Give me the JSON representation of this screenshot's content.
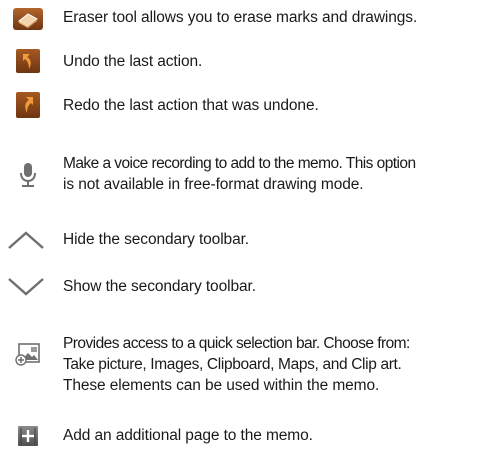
{
  "entries": [
    {
      "icon": "eraser-icon",
      "lines": [
        "Eraser tool allows you to erase marks and drawings."
      ]
    },
    {
      "icon": "undo-icon",
      "lines": [
        "Undo the last action."
      ]
    },
    {
      "icon": "redo-icon",
      "lines": [
        "Redo the last action that was undone."
      ]
    },
    {
      "icon": "microphone-icon",
      "lines": [
        "Make a voice recording to add to the memo. This option",
        "is not available in free-format drawing mode."
      ]
    },
    {
      "icon": "chevron-up-icon",
      "lines": [
        "Hide the secondary toolbar."
      ]
    },
    {
      "icon": "chevron-down-icon",
      "lines": [
        "Show the secondary toolbar."
      ]
    },
    {
      "icon": "insert-media-icon",
      "lines": [
        "Provides access to a quick selection bar. Choose from:",
        "Take picture, Images, Clipboard, Maps, and Clip art.",
        "These elements can be used within the memo."
      ]
    },
    {
      "icon": "add-page-icon",
      "lines": [
        "Add an additional page to the memo."
      ]
    }
  ],
  "colors": {
    "icon_brown": "#8a4a1c",
    "icon_orange": "#e08a2c",
    "icon_gray": "#7d7d7d",
    "text": "#1a1a1a"
  }
}
